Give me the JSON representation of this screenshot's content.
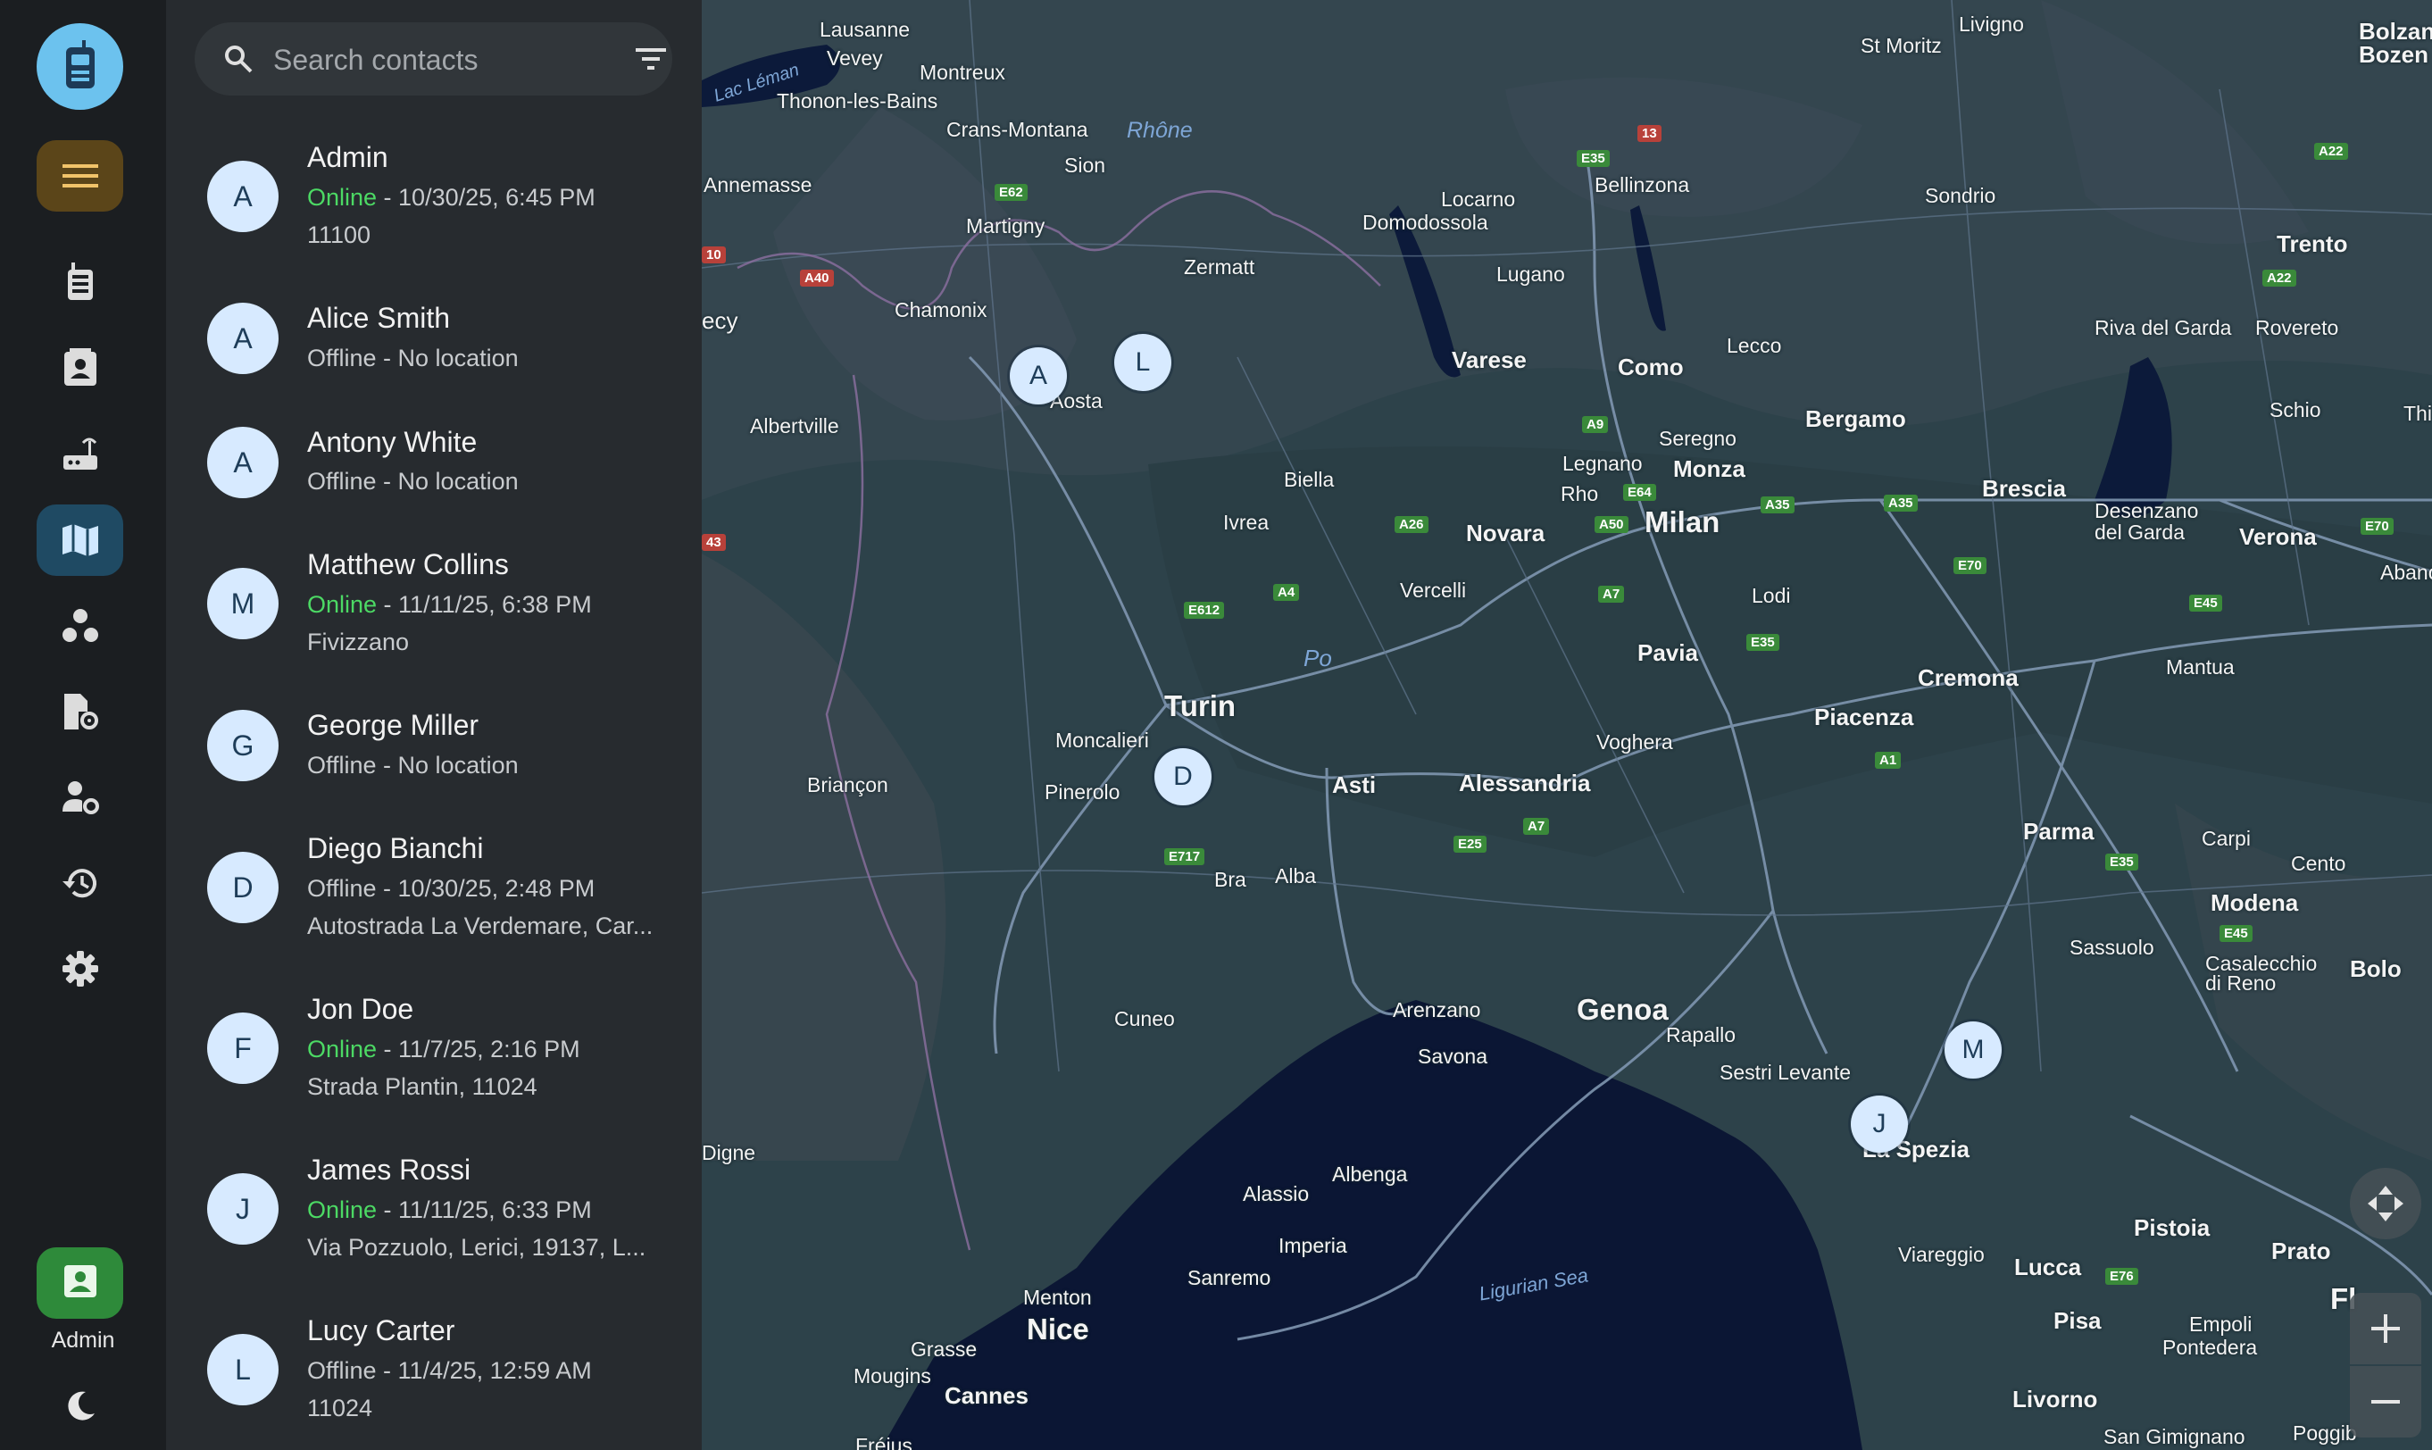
{
  "app": {
    "logo_icon": "walkie-talkie-icon",
    "accent": "#6cc2ee"
  },
  "nav": {
    "items": [
      {
        "name": "menu-icon"
      },
      {
        "name": "radio-icon"
      },
      {
        "name": "contacts-book-icon"
      },
      {
        "name": "router-icon"
      },
      {
        "name": "map-icon",
        "active": true
      },
      {
        "name": "groups-icon"
      },
      {
        "name": "device-settings-icon"
      },
      {
        "name": "user-settings-icon"
      },
      {
        "name": "history-icon"
      },
      {
        "name": "settings-icon"
      }
    ],
    "profile": {
      "label": "Admin",
      "icon": "contact-card-icon"
    },
    "theme_icon": "moon-icon"
  },
  "search": {
    "placeholder": "Search contacts",
    "value": ""
  },
  "contacts": [
    {
      "initial": "A",
      "name": "Admin",
      "online": true,
      "status": "Online",
      "time": " - 10/30/25, 6:45 PM",
      "extra": "11100"
    },
    {
      "initial": "A",
      "name": "Alice Smith",
      "online": false,
      "status": "Offline",
      "time": " - No location",
      "extra": ""
    },
    {
      "initial": "A",
      "name": "Antony White",
      "online": false,
      "status": "Offline",
      "time": " - No location",
      "extra": ""
    },
    {
      "initial": "M",
      "name": "Matthew Collins",
      "online": true,
      "status": "Online",
      "time": " - 11/11/25, 6:38 PM",
      "extra": "Fivizzano"
    },
    {
      "initial": "G",
      "name": "George Miller",
      "online": false,
      "status": "Offline",
      "time": " - No location",
      "extra": ""
    },
    {
      "initial": "D",
      "name": "Diego Bianchi",
      "online": false,
      "status": "Offline",
      "time": " - 10/30/25, 2:48 PM",
      "extra": "Autostrada La Verdemare, Car..."
    },
    {
      "initial": "F",
      "name": "Jon Doe",
      "online": true,
      "status": "Online",
      "time": " - 11/7/25, 2:16 PM",
      "extra": "Strada Plantin, 11024"
    },
    {
      "initial": "J",
      "name": "James Rossi",
      "online": true,
      "status": "Online",
      "time": " - 11/11/25, 6:33 PM",
      "extra": "Via Pozzuolo, Lerici, 19137, L..."
    },
    {
      "initial": "L",
      "name": "Lucy Carter",
      "online": false,
      "status": "Offline",
      "time": " - 11/4/25, 12:59 AM",
      "extra": "11024"
    }
  ],
  "map": {
    "cities": [
      "Lausanne",
      "Vevey",
      "Montreux",
      "Lac Léman",
      "Thonon-les-Bains",
      "Crans-Montana",
      "Rhône",
      "Sion",
      "Annemasse",
      "Martigny",
      "Zermatt",
      "Domodossola",
      "Locarno",
      "Bellinzona",
      "Livigno",
      "St Moritz",
      "Sondrio",
      "Bolzano",
      "Bozen",
      "Trento",
      "Riva del Garda",
      "Rovereto",
      "Schio",
      "Thi",
      "Lugano",
      "Varese",
      "Como",
      "Lecco",
      "Bergamo",
      "Seregno",
      "Legnano",
      "Monza",
      "Rho",
      "Milan",
      "Brescia",
      "Desenzano del Garda",
      "Verona",
      "Abano",
      "Chamonix",
      "Aosta",
      "Albertville",
      "Biella",
      "Ivrea",
      "Novara",
      "Vercelli",
      "Lodi",
      "Mantua",
      "Po",
      "Pavia",
      "Cremona",
      "Turin",
      "Moncalieri",
      "Pinerolo",
      "Asti",
      "Alessandria",
      "Voghera",
      "Piacenza",
      "Parma",
      "Carpi",
      "Cento",
      "Briançon",
      "Bra",
      "Alba",
      "Modena",
      "Sassuolo",
      "Casalecchio di Reno",
      "Bolo",
      "Cuneo",
      "Arenzano",
      "Genoa",
      "Rapallo",
      "Savona",
      "Sestri Levante",
      "La Spezia",
      "Digne",
      "Albenga",
      "Alassio",
      "Imperia",
      "Sanremo",
      "Ligurian Sea",
      "Viareggio",
      "Lucca",
      "Pistoia",
      "Prato",
      "Menton",
      "Nice",
      "Grasse",
      "Mougins",
      "Cannes",
      "Pisa",
      "Empoli",
      "Pontedera",
      "Livorno",
      "San Gimignano",
      "Poggib",
      "Fréjus",
      "ecy",
      "Fl"
    ],
    "markers": [
      {
        "label": "A"
      },
      {
        "label": "L"
      },
      {
        "label": "D"
      },
      {
        "label": "M"
      },
      {
        "label": "J"
      }
    ],
    "controls": {
      "recenter_icon": "recenter-icon",
      "zoom_in_icon": "plus-icon",
      "zoom_out_icon": "minus-icon"
    }
  }
}
